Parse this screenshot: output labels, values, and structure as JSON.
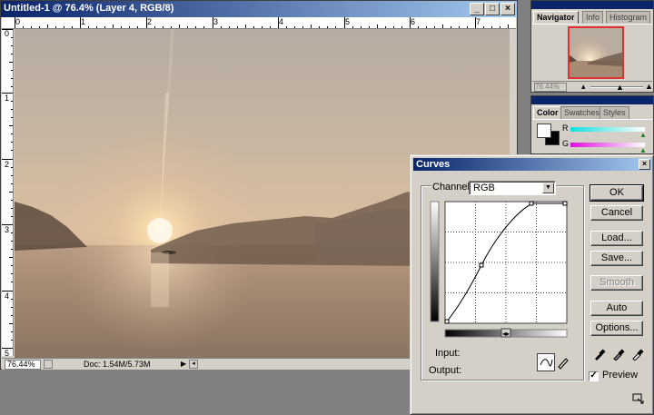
{
  "document": {
    "title": "Untitled-1 @ 76.4% (Layer 4, RGB/8)",
    "zoom": "76.44%",
    "doc_info": "Doc: 1.54M/5.73M",
    "ruler_top_labels": [
      "0",
      "1",
      "2",
      "3",
      "4",
      "5",
      "6",
      "7"
    ],
    "ruler_left_labels": [
      "0",
      "1",
      "2",
      "3",
      "4",
      "5"
    ]
  },
  "navigator": {
    "tabs": [
      "Navigator",
      "Info",
      "Histogram"
    ],
    "zoom": "76.44%"
  },
  "color_palette": {
    "tabs": [
      "Color",
      "Swatches",
      "Styles"
    ],
    "slider_labels": [
      "R",
      "G"
    ],
    "colors": {
      "r_track": "#19e6e6",
      "g_track": "#e619e6"
    }
  },
  "curves": {
    "title": "Curves",
    "channel_label": "Channel:",
    "channel_value": "RGB",
    "input_label": "Input:",
    "output_label": "Output:",
    "buttons": {
      "ok": "OK",
      "cancel": "Cancel",
      "load": "Load...",
      "save": "Save...",
      "smooth": "Smooth",
      "auto": "Auto",
      "options": "Options..."
    },
    "preview_label": "Preview",
    "preview_checked": true
  },
  "colors": {
    "title_bar_start": "#0a246a",
    "title_bar_end": "#a6caf0",
    "workspace": "#808080",
    "chrome": "#d4d0c8"
  }
}
